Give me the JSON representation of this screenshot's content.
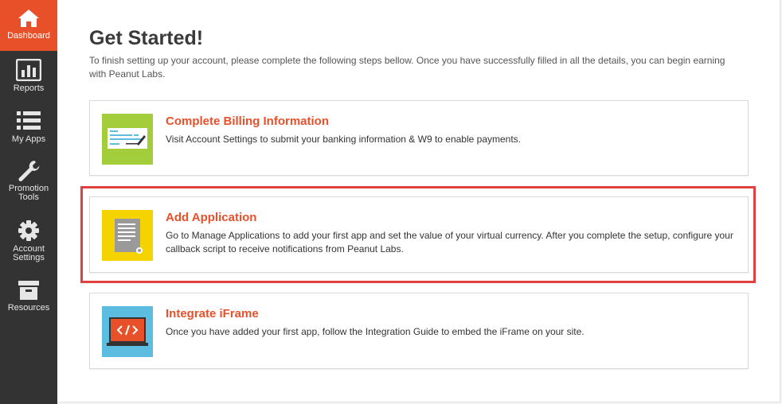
{
  "sidebar": {
    "items": [
      {
        "label": "Dashboard"
      },
      {
        "label": "Reports"
      },
      {
        "label": "My Apps"
      },
      {
        "label_line1": "Promotion",
        "label_line2": "Tools"
      },
      {
        "label_line1": "Account",
        "label_line2": "Settings"
      },
      {
        "label": "Resources"
      }
    ]
  },
  "main": {
    "title": "Get Started!",
    "intro": "To finish setting up your account, please complete the following steps bellow. Once you have successfully filled in all the details, you can begin earning with Peanut Labs.",
    "cards": [
      {
        "title": "Complete Billing Information",
        "text": "Visit Account Settings to submit your banking information & W9 to enable payments.",
        "icon": "check-signing-icon",
        "icon_bg": "#a3cd3b",
        "highlighted": false
      },
      {
        "title": "Add Application",
        "text": "Go to Manage Applications to add your first app and set the value of your virtual currency. After you complete the setup, configure your callback script to receive notifications from Peanut Labs.",
        "icon": "document-icon",
        "icon_bg": "#f5d300",
        "highlighted": true
      },
      {
        "title": "Integrate iFrame",
        "text": "Once you have added your first app, follow the Integration Guide to embed the iFrame on your site.",
        "icon": "code-screen-icon",
        "icon_bg": "#5dbde0",
        "highlighted": false
      }
    ]
  },
  "colors": {
    "accent": "#e8502a",
    "sidebar_bg": "#333333",
    "highlight_border": "#e04040"
  }
}
